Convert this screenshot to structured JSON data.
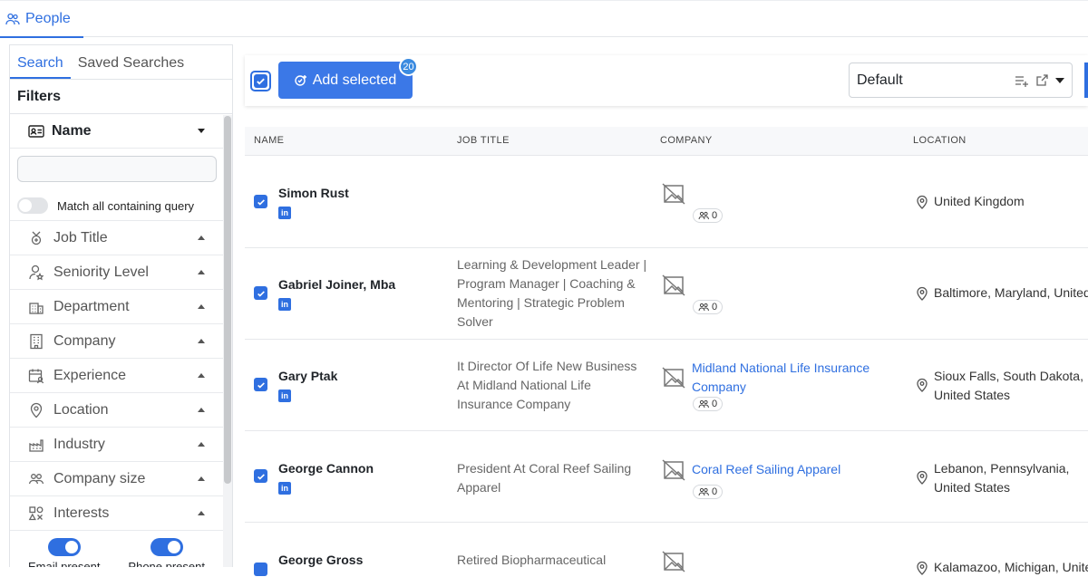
{
  "nav": {
    "people_tab": "People"
  },
  "sidebar": {
    "tabs": [
      "Search",
      "Saved Searches"
    ],
    "filters_heading": "Filters",
    "name_filter": "Name",
    "match_all_label": "Match all containing query",
    "filters": [
      {
        "label": "Job Title",
        "icon": "badge-icon"
      },
      {
        "label": "Seniority Level",
        "icon": "user-star-icon"
      },
      {
        "label": "Department",
        "icon": "building-icon"
      },
      {
        "label": "Company",
        "icon": "office-icon"
      },
      {
        "label": "Experience",
        "icon": "calendar-user-icon"
      },
      {
        "label": "Location",
        "icon": "location-pin-icon"
      },
      {
        "label": "Industry",
        "icon": "factory-icon"
      },
      {
        "label": "Company size",
        "icon": "people-icon"
      },
      {
        "label": "Interests",
        "icon": "shapes-icon"
      }
    ],
    "email_present": "Email present",
    "phone_present": "Phone present"
  },
  "toolbar": {
    "add_selected": "Add selected",
    "selected_count": "20",
    "view_value": "Default"
  },
  "table": {
    "headers": [
      "NAME",
      "JOB TITLE",
      "COMPANY",
      "LOCATION"
    ],
    "rows": [
      {
        "name": "Simon Rust",
        "job": "",
        "company": "",
        "employees": "0",
        "location": "United Kingdom"
      },
      {
        "name": "Gabriel Joiner, Mba",
        "job": "Learning & Development Leader | Program Manager | Coaching & Mentoring | Strategic Problem Solver",
        "company": "",
        "employees": "0",
        "location": "Baltimore, Maryland, United"
      },
      {
        "name": "Gary Ptak",
        "job": "It Director Of Life New Business At Midland National Life Insurance Company",
        "company": "Midland National Life Insurance Company",
        "employees": "0",
        "location": "Sioux Falls, South Dakota, United States"
      },
      {
        "name": "George Cannon",
        "job": "President At Coral Reef Sailing Apparel",
        "company": "Coral Reef Sailing Apparel",
        "employees": "0",
        "location": "Lebanon, Pennsylvania, United States"
      },
      {
        "name": "George Gross",
        "job": "Retired Biopharmaceutical",
        "company": "",
        "employees": "",
        "location": "Kalamazoo, Michigan, United"
      }
    ]
  },
  "colors": {
    "accent": "#2f6fe0",
    "button": "#3b78e7"
  }
}
